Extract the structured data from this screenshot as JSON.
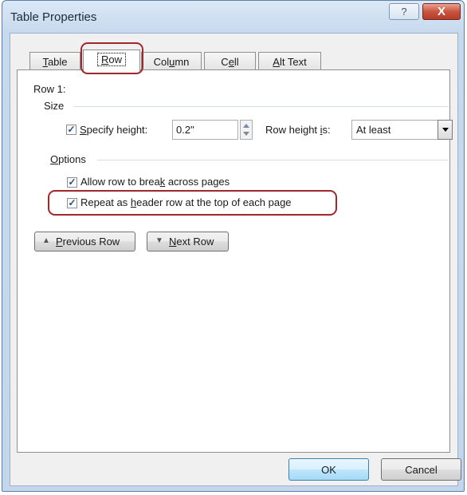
{
  "window": {
    "title": "Table Properties",
    "help_label": "?",
    "close_label": "X"
  },
  "tabs": [
    {
      "label": "Table",
      "key": "T",
      "rest": "able",
      "active": false
    },
    {
      "label": "Row",
      "key": "R",
      "rest": "ow",
      "active": true
    },
    {
      "label": "Column",
      "pre": "Col",
      "key": "u",
      "rest": "mn",
      "active": false
    },
    {
      "label": "Cell",
      "pre": "C",
      "key": "e",
      "rest": "ll",
      "active": false
    },
    {
      "label": "Alt Text",
      "key": "A",
      "rest": "lt Text",
      "active": false
    }
  ],
  "row_panel": {
    "row_heading": "Row 1:",
    "size_group": "Size",
    "specify_height": {
      "pre": "",
      "key": "S",
      "rest": "pecify height:",
      "checked": true
    },
    "height_value": "0.2\"",
    "row_height_is": {
      "pre": "Row height ",
      "key": "i",
      "rest": "s:"
    },
    "height_rule": "At least",
    "options_group": {
      "key": "O",
      "rest": "ptions"
    },
    "allow_break": {
      "pre": "Allow row to brea",
      "key": "k",
      "rest": " across pages",
      "checked": true
    },
    "repeat_header": {
      "pre": "Repeat as ",
      "key": "h",
      "rest": "eader row at the top of each page",
      "checked": true
    },
    "previous_row": {
      "key": "P",
      "rest": "revious Row"
    },
    "next_row": {
      "key": "N",
      "rest": "ext Row"
    }
  },
  "footer": {
    "ok_label": "OK",
    "cancel_label": "Cancel"
  },
  "colors": {
    "callout": "#a0282d",
    "close_button": "#c9553f"
  }
}
